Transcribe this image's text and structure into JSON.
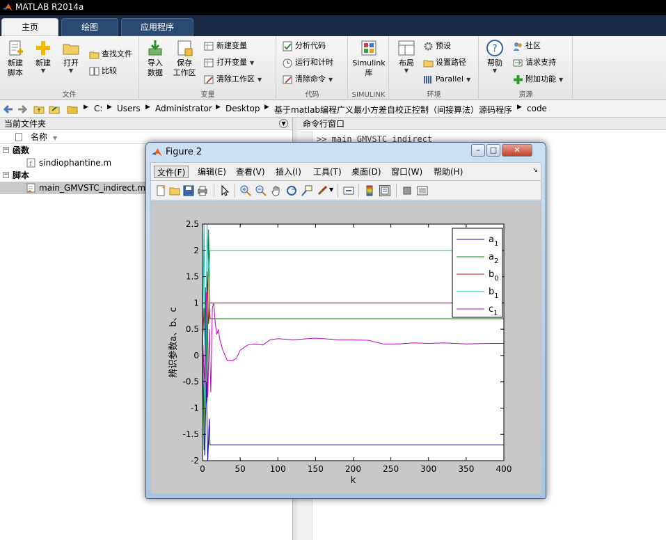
{
  "app": {
    "title": "MATLAB R2014a"
  },
  "tabs": [
    {
      "label": "主页",
      "active": true
    },
    {
      "label": "绘图",
      "active": false
    },
    {
      "label": "应用程序",
      "active": false
    }
  ],
  "ribbon": {
    "file": {
      "group_label": "文件",
      "new_script": "新建\n脚本",
      "new": "新建",
      "open": "打开",
      "find_files": "查找文件",
      "compare": "比较"
    },
    "variable": {
      "group_label": "变量",
      "import_data": "导入\n数据",
      "save_workspace": "保存\n工作区",
      "new_variable": "新建变量",
      "open_variable": "打开变量",
      "clear_workspace": "清除工作区"
    },
    "code": {
      "group_label": "代码",
      "analyze_code": "分析代码",
      "run_and_time": "运行和计时",
      "clear_commands": "清除命令"
    },
    "simulink": {
      "group_label": "SIMULINK",
      "library": "Simulink\n库"
    },
    "environment": {
      "group_label": "环境",
      "layout": "布局",
      "preferences": "预设",
      "set_path": "设置路径",
      "parallel": "Parallel"
    },
    "resources": {
      "group_label": "资源",
      "help": "帮助",
      "community": "社区",
      "request_support": "请求支持",
      "addons": "附加功能"
    }
  },
  "address": {
    "crumbs": [
      "C:",
      "Users",
      "Administrator",
      "Desktop",
      "基于matlab编程广义最小方差自校正控制（间接算法）源码程序",
      "code"
    ]
  },
  "current_folder": {
    "title": "当前文件夹",
    "column_name": "名称",
    "groups": [
      {
        "label": "函数",
        "files": [
          {
            "name": "sindiophantine.m",
            "selected": false
          }
        ]
      },
      {
        "label": "脚本",
        "files": [
          {
            "name": "main_GMVSTC_indirect.m",
            "selected": true
          }
        ]
      }
    ]
  },
  "command_window": {
    "title": "命令行窗口",
    "text": ">> main_GMVSTC_indirect"
  },
  "figure": {
    "title": "Figure 2",
    "menus": [
      "文件(F)",
      "编辑(E)",
      "查看(V)",
      "插入(I)",
      "工具(T)",
      "桌面(D)",
      "窗口(W)",
      "帮助(H)"
    ],
    "active_menu": 0
  },
  "chart_data": {
    "type": "line",
    "title": "",
    "xlabel": "k",
    "ylabel": "辨识参数a、b、c",
    "xlim": [
      0,
      400
    ],
    "ylim": [
      -2,
      2.5
    ],
    "xticks": [
      "0",
      "50",
      "100",
      "150",
      "200",
      "250",
      "300",
      "350",
      "400"
    ],
    "yticks": [
      "-2",
      "-1.5",
      "-1",
      "-0.5",
      "0",
      "0.5",
      "1",
      "1.5",
      "2",
      "2.5"
    ],
    "grid": false,
    "legend_location": "top-right",
    "series": [
      {
        "name": "a",
        "sub": "1",
        "color": "#0000bf",
        "x": [
          0,
          3,
          5,
          7,
          9,
          10,
          12,
          400
        ],
        "y": [
          0.3,
          -1.9,
          -0.5,
          -2.0,
          -1.2,
          -1.7,
          -1.7,
          -1.7
        ]
      },
      {
        "name": "a",
        "sub": "2",
        "color": "#007f00",
        "x": [
          0,
          2,
          4,
          6,
          8,
          10,
          12,
          400
        ],
        "y": [
          0.5,
          -1.8,
          1.3,
          -0.9,
          2.4,
          0.7,
          0.7,
          0.7
        ]
      },
      {
        "name": "b",
        "sub": "0",
        "color": "#bf0000",
        "x": [
          0,
          2,
          4,
          6,
          8,
          10,
          12,
          400
        ],
        "y": [
          0.2,
          0.9,
          -0.3,
          1.6,
          0.6,
          1.0,
          1.0,
          1.0
        ]
      },
      {
        "name": "b",
        "sub": "1",
        "color": "#00bfbf",
        "x": [
          0,
          2,
          4,
          6,
          8,
          10,
          12,
          400
        ],
        "y": [
          0.0,
          2.5,
          -1.0,
          2.5,
          1.5,
          2.0,
          2.0,
          2.0
        ]
      },
      {
        "name": "c",
        "sub": "1",
        "color": "#bf00bf",
        "x": [
          0,
          3,
          5,
          7,
          9,
          11,
          13,
          15,
          17,
          19,
          21,
          23,
          25,
          27,
          30,
          33,
          36,
          40,
          45,
          50,
          55,
          60,
          70,
          80,
          90,
          100,
          120,
          150,
          180,
          200,
          220,
          240,
          260,
          280,
          300,
          320,
          350,
          380,
          400
        ],
        "y": [
          0.4,
          -0.6,
          1.2,
          -0.8,
          0.5,
          -0.7,
          0.9,
          1.0,
          0.6,
          0.4,
          0.5,
          0.3,
          0.2,
          0.1,
          0.0,
          -0.1,
          -0.1,
          -0.1,
          -0.05,
          0.1,
          0.15,
          0.2,
          0.22,
          0.2,
          0.3,
          0.32,
          0.3,
          0.33,
          0.3,
          0.3,
          0.29,
          0.22,
          0.22,
          0.24,
          0.23,
          0.24,
          0.22,
          0.23,
          0.23
        ]
      }
    ]
  }
}
